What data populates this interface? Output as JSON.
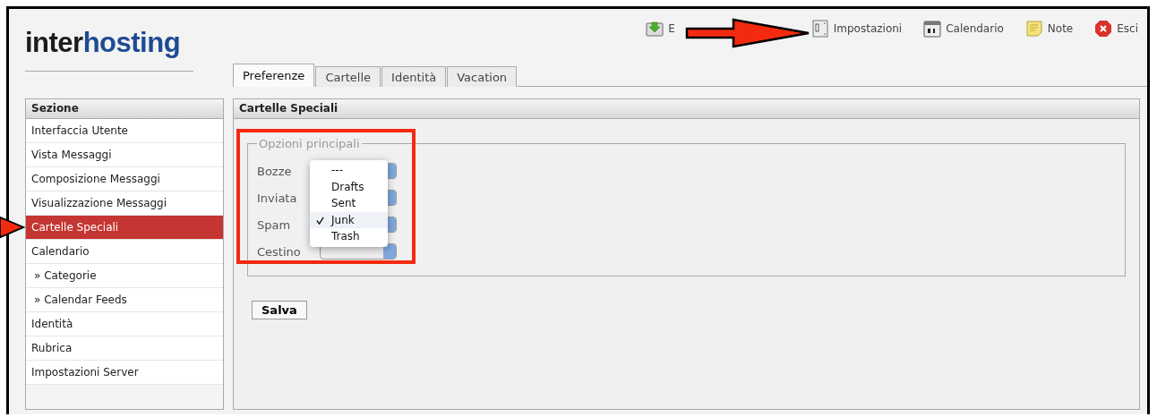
{
  "logo": {
    "part_1": "inter",
    "part_2": "hosting"
  },
  "toolbar": [
    {
      "label": "E"
    },
    {
      "label": "Impostazioni"
    },
    {
      "label": "Calendario"
    },
    {
      "label": "Note"
    },
    {
      "label": "Esci"
    }
  ],
  "tabs": [
    {
      "label": "Preferenze",
      "selected": true
    },
    {
      "label": "Cartelle",
      "selected": false
    },
    {
      "label": "Identità",
      "selected": false
    },
    {
      "label": "Vacation",
      "selected": false
    }
  ],
  "sidebar": {
    "title": "Sezione",
    "items": [
      {
        "label": "Interfaccia Utente",
        "selected": false
      },
      {
        "label": "Vista Messaggi",
        "selected": false
      },
      {
        "label": "Composizione Messaggi",
        "selected": false
      },
      {
        "label": "Visualizzazione Messaggi",
        "selected": false
      },
      {
        "label": "Cartelle Speciali",
        "selected": true
      },
      {
        "label": "Calendario",
        "selected": false,
        "children": [
          {
            "label": "» Categorie",
            "selected": false
          },
          {
            "label": "» Calendar Feeds",
            "selected": false
          }
        ]
      },
      {
        "label": "Identità",
        "selected": false
      },
      {
        "label": "Rubrica",
        "selected": false
      },
      {
        "label": "Impostazioni Server",
        "selected": false
      }
    ]
  },
  "panel": {
    "title": "Cartelle Speciali",
    "fieldset": {
      "legend": "Opzioni principali",
      "fields": [
        {
          "label": "Bozze"
        },
        {
          "label": "Inviata"
        },
        {
          "label": "Spam"
        },
        {
          "label": "Cestino"
        }
      ]
    },
    "dropdown": {
      "options": [
        {
          "label": "---",
          "selected": false
        },
        {
          "label": "Drafts",
          "selected": false
        },
        {
          "label": "Sent",
          "selected": false
        },
        {
          "label": "Junk",
          "selected": true
        },
        {
          "label": "Trash",
          "selected": false
        }
      ]
    },
    "button": "Salva"
  }
}
